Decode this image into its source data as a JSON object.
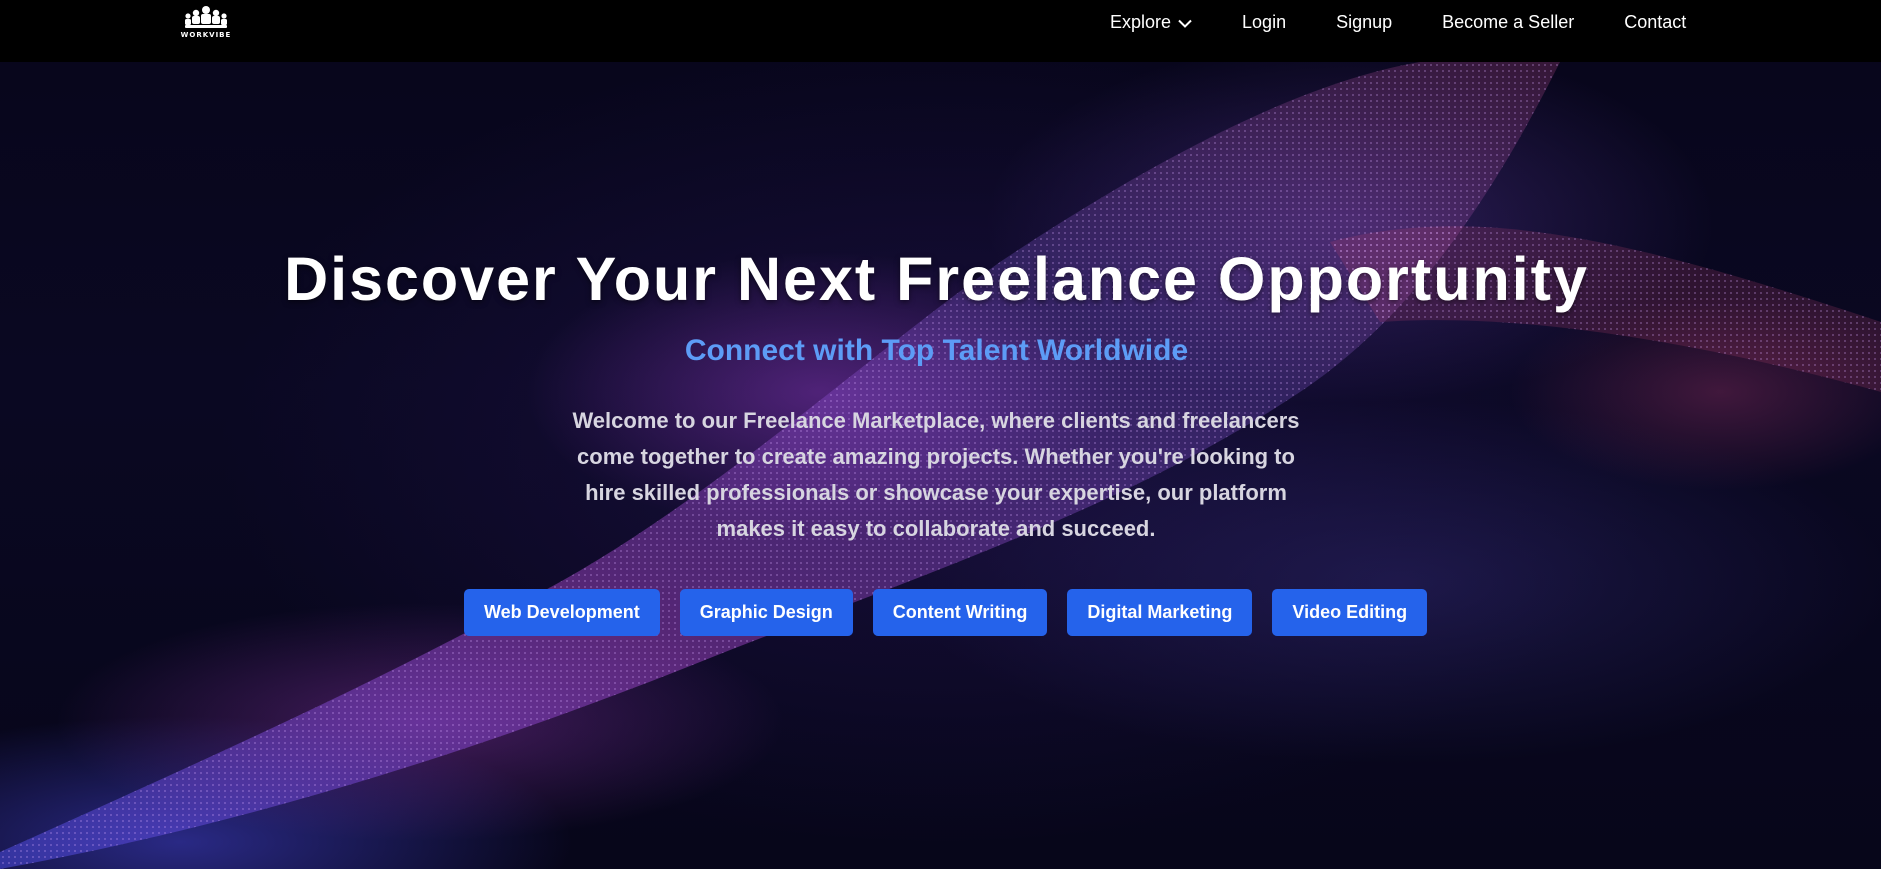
{
  "brand": {
    "logo_text": "WORKVIBE",
    "logo_icon": "people-group-icon"
  },
  "nav": {
    "explore_label": "Explore",
    "explore_icon": "chevron-down-icon",
    "login_label": "Login",
    "signup_label": "Signup",
    "seller_label": "Become a Seller",
    "contact_label": "Contact"
  },
  "hero": {
    "title": "Discover Your Next Freelance Opportunity",
    "subtitle": "Connect with Top Talent Worldwide",
    "description": "Welcome to our Freelance Marketplace, where clients and freelancers come together to create amazing projects. Whether you're looking to hire skilled professionals or showcase your expertise, our platform makes it easy to collaborate and succeed.",
    "categories": [
      {
        "label": "Web Development"
      },
      {
        "label": "Graphic Design"
      },
      {
        "label": "Content Writing"
      },
      {
        "label": "Digital Marketing"
      },
      {
        "label": "Video Editing"
      }
    ]
  },
  "colors": {
    "nav_background": "#000000",
    "accent_blue": "#2563eb",
    "subtitle_blue": "#5d9cf6",
    "hero_background": "#06051a"
  }
}
